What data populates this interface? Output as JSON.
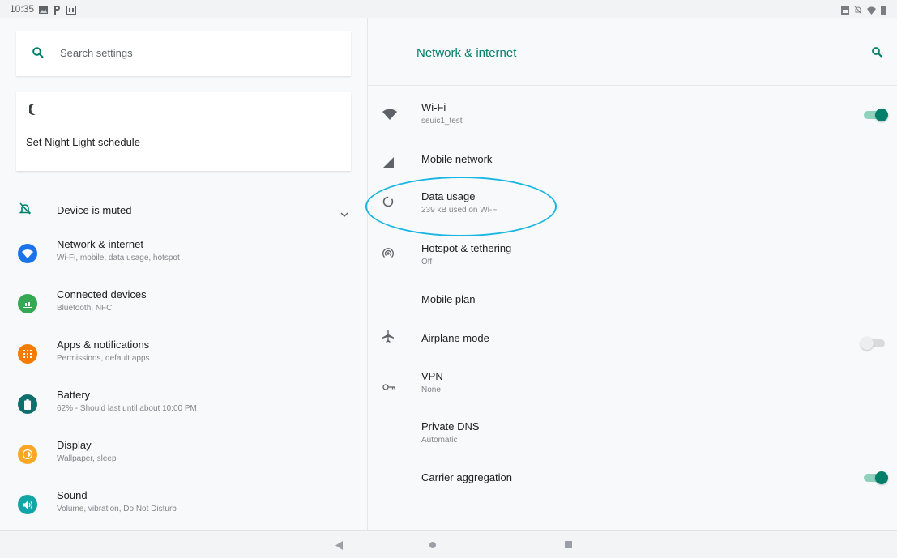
{
  "status_bar": {
    "time": "10:35",
    "icons": [
      "image-icon",
      "p-icon",
      "calendar-icon",
      "screenshot-icon",
      "mute-icon",
      "wifi-icon",
      "battery-icon"
    ]
  },
  "left": {
    "search_placeholder": "Search settings",
    "night_light": {
      "label": "Set Night Light schedule",
      "icon": "moon-icon"
    },
    "muted": {
      "label": "Device is muted",
      "icon": "bell-off-icon"
    },
    "items": [
      {
        "title": "Network & internet",
        "subtitle": "Wi-Fi, mobile, data usage, hotspot",
        "icon": "wifi-icon",
        "color": "#1a73e8"
      },
      {
        "title": "Connected devices",
        "subtitle": "Bluetooth, NFC",
        "icon": "devices-icon",
        "color": "#34a853"
      },
      {
        "title": "Apps & notifications",
        "subtitle": "Permissions, default apps",
        "icon": "apps-icon",
        "color": "#f57c00"
      },
      {
        "title": "Battery",
        "subtitle": "62% - Should last until about 10:00 PM",
        "icon": "battery-icon",
        "color": "#0f6e6e"
      },
      {
        "title": "Display",
        "subtitle": "Wallpaper, sleep",
        "icon": "brightness-icon",
        "color": "#f9a825"
      },
      {
        "title": "Sound",
        "subtitle": "Volume, vibration, Do Not Disturb",
        "icon": "volume-icon",
        "color": "#12a5a5"
      }
    ]
  },
  "right": {
    "title": "Network & internet",
    "items": [
      {
        "title": "Wi-Fi",
        "subtitle": "seuic1_test",
        "icon": "wifi-icon",
        "toggle": "on"
      },
      {
        "title": "Mobile network",
        "icon": "signal-icon"
      },
      {
        "title": "Data usage",
        "subtitle": "239 kB used on Wi-Fi",
        "icon": "data-usage-icon"
      },
      {
        "title": "Hotspot & tethering",
        "subtitle": "Off",
        "icon": "hotspot-icon"
      },
      {
        "title": "Mobile plan"
      },
      {
        "title": "Airplane mode",
        "icon": "airplane-icon",
        "toggle": "off"
      },
      {
        "title": "VPN",
        "subtitle": "None",
        "icon": "vpn-key-icon"
      },
      {
        "title": "Private DNS",
        "subtitle": "Automatic"
      },
      {
        "title": "Carrier aggregation",
        "toggle": "on"
      }
    ]
  },
  "colors": {
    "accent": "#00806a",
    "highlight": "#19b6e3"
  }
}
